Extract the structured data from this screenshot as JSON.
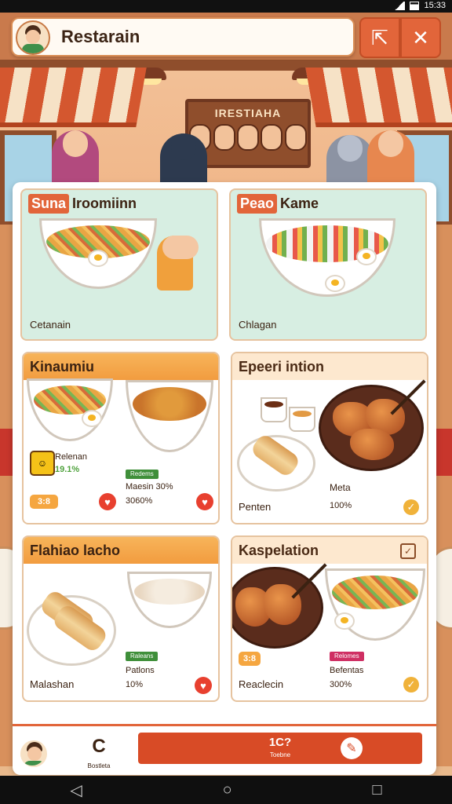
{
  "status": {
    "time": "15:33"
  },
  "app": {
    "title": "Restarain"
  },
  "scene": {
    "board_text": "IRESTIAHA"
  },
  "cards": [
    {
      "id": "c1",
      "title_tag": "Suna",
      "title": "Iroomiinn",
      "caption": "Cetanain"
    },
    {
      "id": "c2",
      "title_tag": "Peao",
      "title": "Kame",
      "caption": "Chlagan"
    },
    {
      "id": "c3",
      "title": "Kinaumiu",
      "brand": "Relenan",
      "brand_pct": "19.1%",
      "badge": "Redems",
      "name": "Maesin 30%",
      "pct": "3060%",
      "pill": "3:8"
    },
    {
      "id": "c4",
      "title": "Epeeri intion",
      "name_left": "Penten",
      "name_right": "Meta",
      "pct": "100%"
    },
    {
      "id": "c5",
      "title": "Flahiao lacho",
      "badge": "Raleans",
      "name_left": "Malashan",
      "name_right": "Patlons",
      "pct": "10%"
    },
    {
      "id": "c6",
      "title": "Kaspelation",
      "pill": "3:8",
      "badge": "Relomes",
      "name_left": "Reaclecin",
      "name_right": "Befentas",
      "pct": "300%"
    }
  ],
  "bottom": {
    "nav_label": "Bostleta",
    "action_main": "1C?",
    "action_sub": "Toebne"
  },
  "icons": {
    "share": "share-icon",
    "close": "close-icon",
    "heart": "heart-icon",
    "check": "check-icon",
    "edit": "edit-icon",
    "back": "back-icon",
    "home": "home-icon",
    "recents": "recents-icon"
  },
  "colors": {
    "accent": "#e2653a",
    "header_orange": "#f29c3f",
    "mint": "#d7eee2"
  }
}
